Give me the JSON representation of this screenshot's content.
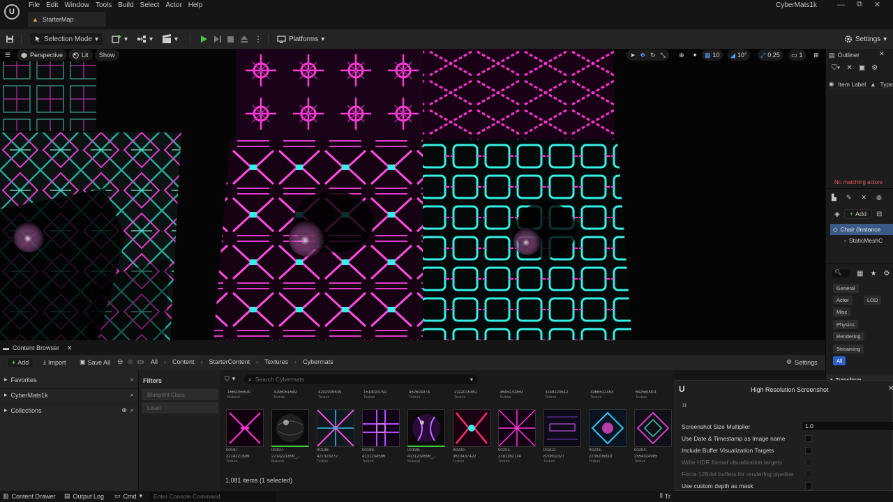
{
  "app": {
    "title": "CyberMats1k",
    "map_tab": "StarterMap"
  },
  "menu": [
    "File",
    "Edit",
    "Window",
    "Tools",
    "Build",
    "Select",
    "Actor",
    "Help"
  ],
  "window_controls": [
    "—",
    "⧉",
    "✕"
  ],
  "toolbar": {
    "mode": "Selection Mode",
    "platforms": "Platforms",
    "settings": "Settings"
  },
  "viewport": {
    "perspective": "Perspective",
    "lit": "Lit",
    "show": "Show",
    "grid_snap": "10",
    "rot_snap": "10°",
    "scale_snap": "0.25",
    "cam_speed": "1",
    "colors": {
      "magenta": "#ff3ad8",
      "cyan": "#36f0e6",
      "teal": "#2aa89a"
    }
  },
  "outliner": {
    "title": "Outliner",
    "column_label": "Item Label",
    "column_type": "Type",
    "empty_text": "No matching actors"
  },
  "details": {
    "add": "Add",
    "components": [
      "Chair (Instance",
      "StaticMeshC"
    ],
    "categories": [
      "General",
      "Actor",
      "LOD",
      "Misc",
      "Physics",
      "Rendering",
      "Streaming",
      "All"
    ],
    "section": "Transform"
  },
  "content_browser": {
    "tab": "Content Browser",
    "add": "Add",
    "import": "Import",
    "save_all": "Save All",
    "breadcrumb": [
      "All",
      "Content",
      "StarterContent",
      "Textures",
      "Cybermats"
    ],
    "settings": "Settings",
    "favorites": "Favorites",
    "project": "CyberMats1k",
    "collections": "Collections",
    "filters_title": "Filters",
    "filters": [
      "Blueprint Class",
      "Level"
    ],
    "search_placeholder": "Search Cybermats",
    "top_row": [
      {
        "label": "1669155530",
        "type": "Material"
      },
      {
        "label": "3198051649",
        "type": "Texture"
      },
      {
        "label": "4202939539",
        "type": "Texture"
      },
      {
        "label": "1514024792",
        "type": "Texture"
      },
      {
        "label": "452504974",
        "type": "Texture"
      },
      {
        "label": "2112015361",
        "type": "Texture"
      },
      {
        "label": "3645179359",
        "type": "Texture"
      },
      {
        "label": "3148120612",
        "type": "Texture"
      },
      {
        "label": "3366512453",
        "type": "Texture"
      },
      {
        "label": "692580901",
        "type": "Texture"
      }
    ],
    "assets": [
      {
        "name": "00197-",
        "id": "2214221699",
        "type": "Texture"
      },
      {
        "name": "00197-",
        "id": "2214221699_...",
        "type": "Material"
      },
      {
        "name": "00198-",
        "id": "427323272",
        "type": "Texture"
      },
      {
        "name": "00199-",
        "id": "4131234596",
        "type": "Texture"
      },
      {
        "name": "00199-",
        "id": "4131234596_...",
        "type": "Material"
      },
      {
        "name": "00200-",
        "id": "3670437422",
        "type": "Texture"
      },
      {
        "name": "00201-",
        "id": "3181162714",
        "type": "Texture"
      },
      {
        "name": "00202-",
        "id": "870802327",
        "type": "Texture"
      },
      {
        "name": "00203-",
        "id": "2235205810",
        "type": "Texture"
      },
      {
        "name": "00204-",
        "id": "2554324985",
        "type": "Texture"
      }
    ],
    "count": "1,081 items (1 selected)"
  },
  "screenshot_panel": {
    "title": "High Resolution Screenshot",
    "size_label": "Screenshot Size Multiplier",
    "size_value": "1.0",
    "options": [
      {
        "label": "Use Date & Timestamp as Image name",
        "enabled": true
      },
      {
        "label": "Include Buffer Visualization Targets",
        "enabled": true
      },
      {
        "label": "Write HDR format visualization targets",
        "enabled": false
      },
      {
        "label": "Force 128-bit buffers for rendering pipeline",
        "enabled": false
      },
      {
        "label": "Use custom depth as mask",
        "enabled": true
      }
    ]
  },
  "statusbar": {
    "content_drawer": "Content Drawer",
    "output_log": "Output Log",
    "cmd": "Cmd",
    "console_placeholder": "Enter Console Command",
    "trace": "Tr"
  }
}
